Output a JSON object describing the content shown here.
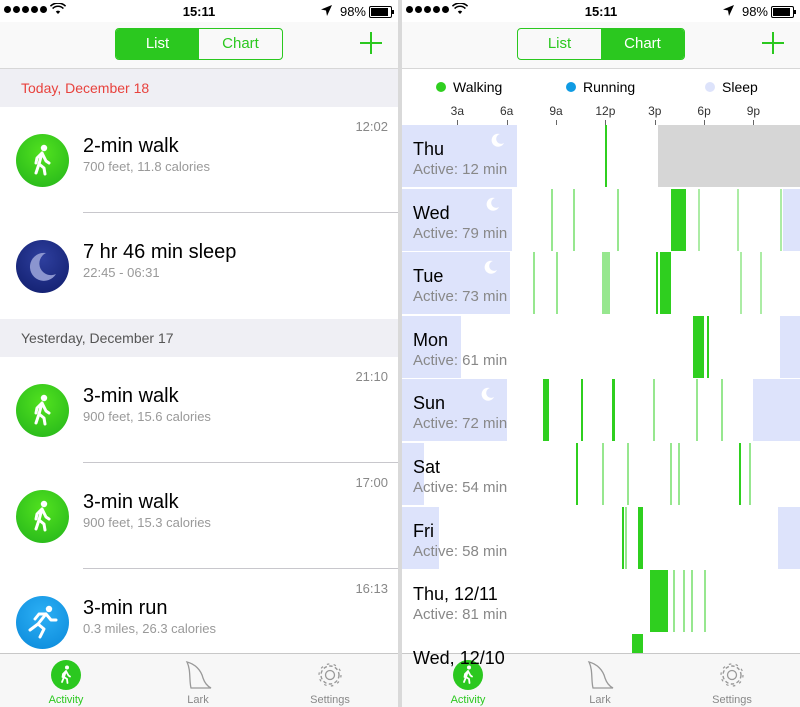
{
  "status": {
    "time": "15:11",
    "battery": "98%"
  },
  "left": {
    "segment": {
      "list_label": "List",
      "chart_label": "Chart",
      "selected": "list"
    },
    "sections": [
      {
        "header": "Today, December 18",
        "items": [
          {
            "time": "12:02",
            "icon": "walk-icon",
            "title": "2-min walk",
            "subtitle": "700 feet, 11.8 calories"
          },
          {
            "time": "",
            "icon": "moon-icon",
            "title": "7 hr 46 min sleep",
            "subtitle": "22:45 - 06:31"
          }
        ]
      },
      {
        "header": "Yesterday, December 17",
        "items": [
          {
            "time": "21:10",
            "icon": "walk-icon",
            "title": "3-min walk",
            "subtitle": "900 feet, 15.6 calories"
          },
          {
            "time": "17:00",
            "icon": "walk-icon",
            "title": "3-min walk",
            "subtitle": "900 feet, 15.3 calories"
          },
          {
            "time": "16:13",
            "icon": "run-icon",
            "title": "3-min run",
            "subtitle": "0.3 miles, 26.3 calories"
          }
        ]
      }
    ]
  },
  "right": {
    "segment": {
      "list_label": "List",
      "chart_label": "Chart",
      "selected": "chart"
    }
  },
  "tabbar": {
    "activity": "Activity",
    "lark": "Lark",
    "settings": "Settings",
    "selected": "activity"
  },
  "colors": {
    "accent": "#2bc81f",
    "walking": "#2fcf1f",
    "running": "#0f9be3",
    "sleep": "#dde3fb",
    "today_header": "#e8423d"
  },
  "chart_data": {
    "type": "heatmap",
    "legend": [
      {
        "name": "Walking",
        "color": "#2fcf1f"
      },
      {
        "name": "Running",
        "color": "#0f9be3"
      },
      {
        "name": "Sleep",
        "color": "#dde3fb"
      }
    ],
    "x_ticks": [
      "3a",
      "6a",
      "9a",
      "12p",
      "3p",
      "6p",
      "9p"
    ],
    "x_range_hours": [
      0,
      24
    ],
    "rows": [
      {
        "day": "Thu",
        "active": "Active: 12 min",
        "sleep": [
          [
            0,
            6.6
          ]
        ],
        "walk": [
          [
            12.0,
            12.1
          ]
        ],
        "future": [
          15.2,
          24
        ]
      },
      {
        "day": "Wed",
        "active": "Active: 79 min",
        "sleep": [
          [
            0,
            6.3
          ],
          [
            22.8,
            24
          ]
        ],
        "walk": [
          [
            8.7,
            8.8,
            0.5
          ],
          [
            10.0,
            10.1,
            0.5
          ],
          [
            12.7,
            12.8,
            0.5
          ],
          [
            16.0,
            16.1
          ],
          [
            16.1,
            16.9
          ],
          [
            17.6,
            17.7,
            0.4
          ],
          [
            20.0,
            20.1,
            0.4
          ],
          [
            22.6,
            22.7,
            0.4
          ]
        ]
      },
      {
        "day": "Tue",
        "active": "Active: 73 min",
        "sleep": [
          [
            0,
            6.2
          ]
        ],
        "walk": [
          [
            7.6,
            7.7,
            0.5
          ],
          [
            9.0,
            9.1,
            0.5
          ],
          [
            11.8,
            12.3,
            0.5
          ],
          [
            15.1,
            15.2
          ],
          [
            15.3,
            16.0
          ],
          [
            20.2,
            20.3,
            0.4
          ],
          [
            21.4,
            21.5,
            0.4
          ]
        ]
      },
      {
        "day": "Mon",
        "active": "Active: 61 min",
        "sleep": [
          [
            0,
            3.2
          ],
          [
            22.6,
            24
          ]
        ],
        "walk": [
          [
            17.3,
            18.0
          ],
          [
            18.2,
            18.3
          ]
        ]
      },
      {
        "day": "Sun",
        "active": "Active: 72 min",
        "sleep": [
          [
            0,
            6.0
          ],
          [
            21.0,
            24
          ]
        ],
        "walk": [
          [
            8.2,
            8.6
          ],
          [
            10.5,
            10.6
          ],
          [
            12.4,
            12.6
          ],
          [
            14.9,
            15.0,
            0.5
          ],
          [
            17.5,
            17.6,
            0.5
          ],
          [
            19.0,
            19.1,
            0.5
          ]
        ]
      },
      {
        "day": "Sat",
        "active": "Active: 54 min",
        "sleep": [
          [
            0,
            1.0
          ]
        ],
        "walk": [
          [
            10.2,
            10.3
          ],
          [
            11.8,
            11.9,
            0.5
          ],
          [
            13.3,
            13.4,
            0.5
          ],
          [
            15.9,
            16.0,
            0.5
          ],
          [
            16.4,
            16.5,
            0.5
          ],
          [
            20.1,
            20.2
          ],
          [
            20.7,
            20.8,
            0.5
          ]
        ]
      },
      {
        "day": "Fri",
        "active": "Active: 58 min",
        "sleep": [
          [
            0,
            1.9
          ],
          [
            22.5,
            24
          ]
        ],
        "walk": [
          [
            13.0,
            13.1
          ],
          [
            13.2,
            13.3,
            0.5
          ],
          [
            14.0,
            14.3
          ]
        ]
      },
      {
        "day": "Thu, 12/11",
        "active": "Active: 81 min",
        "sleep": [],
        "walk": [
          [
            14.7,
            15.8
          ],
          [
            16.1,
            16.2,
            0.5
          ],
          [
            16.7,
            16.8,
            0.5
          ],
          [
            17.2,
            17.3,
            0.5
          ],
          [
            18.0,
            18.1,
            0.5
          ]
        ]
      },
      {
        "day": "Wed, 12/10",
        "active": "",
        "sleep": [],
        "walk": [
          [
            13.6,
            14.3
          ]
        ]
      }
    ]
  }
}
